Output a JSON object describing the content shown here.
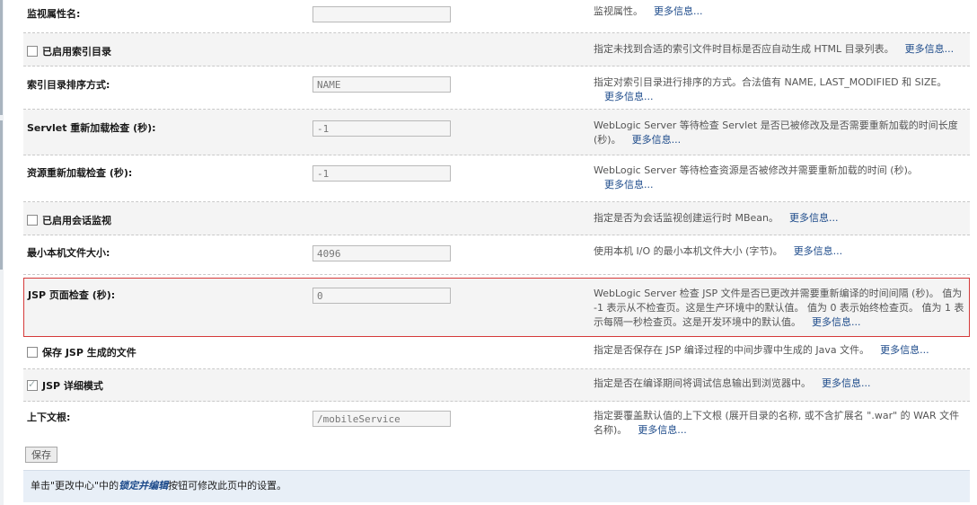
{
  "more_label": "更多信息...",
  "rows": [
    {
      "label": "监视属性名:",
      "value": "",
      "desc": "监视属性。"
    },
    {
      "label": "已启用索引目录",
      "desc": "指定未找到合适的索引文件时目标是否应自动生成 HTML 目录列表。"
    },
    {
      "label": "索引目录排序方式:",
      "value": "NAME",
      "desc": "指定对索引目录进行排序的方式。合法值有 NAME, LAST_MODIFIED 和 SIZE。"
    },
    {
      "label": "Servlet 重新加载检查 (秒):",
      "value": "-1",
      "desc": "WebLogic Server 等待检查 Servlet 是否已被修改及是否需要重新加载的时间长度 (秒)。"
    },
    {
      "label": "资源重新加载检查 (秒):",
      "value": "-1",
      "desc": "WebLogic Server 等待检查资源是否被修改并需要重新加载的时间 (秒)。"
    },
    {
      "label": "已启用会话监视",
      "desc": "指定是否为会话监视创建运行时 MBean。"
    },
    {
      "label": "最小本机文件大小:",
      "value": "4096",
      "desc": "使用本机 I/O 的最小本机文件大小 (字节)。"
    },
    {
      "label": "JSP 页面检查 (秒):",
      "value": "0",
      "desc": "WebLogic Server 检查 JSP 文件是否已更改并需要重新编译的时间间隔 (秒)。 值为 -1 表示从不检查页。这是生产环境中的默认值。 值为 0 表示始终检查页。 值为 1 表示每隔一秒检查页。这是开发环境中的默认值。"
    },
    {
      "label": "保存 JSP 生成的文件",
      "desc": "指定是否保存在 JSP 编译过程的中间步骤中生成的 Java 文件。"
    },
    {
      "label": "JSP 详细模式",
      "desc": "指定是否在编译期间将调试信息输出到浏览器中。"
    },
    {
      "label": "上下文根:",
      "value": "/mobileService",
      "desc": "指定要覆盖默认值的上下文根 (展开目录的名称, 或不含扩展名 \".war\" 的 WAR 文件名称)。"
    }
  ],
  "save_label": "保存",
  "footer": {
    "prefix": "单击\"更改中心\"中的",
    "link": "锁定并编辑",
    "suffix": "按钮可修改此页中的设置。"
  }
}
